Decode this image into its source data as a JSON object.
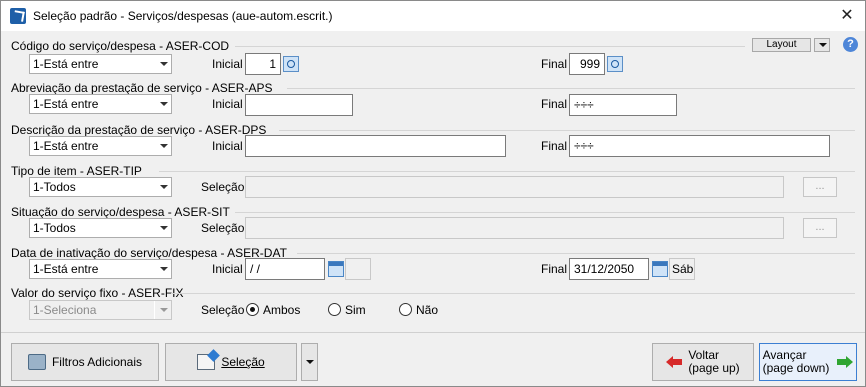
{
  "window": {
    "title": "Seleção padrão - Serviços/despesas (aue-autom.escrit.)",
    "close_glyph": "✕"
  },
  "toolbar": {
    "layout_label": "Layout",
    "help_glyph": "?"
  },
  "groups": [
    {
      "title": "Código do serviço/despesa - ASER-COD",
      "mode": "1-Está entre",
      "left_label": "Inicial",
      "left_value": "1",
      "right_label": "Final",
      "right_value": "999"
    },
    {
      "title": "Abreviação da prestação de serviço - ASER-APS",
      "mode": "1-Está entre",
      "left_label": "Inicial",
      "left_value": "",
      "right_label": "Final",
      "right_value": "÷÷÷"
    },
    {
      "title": "Descrição da prestação de serviço - ASER-DPS",
      "mode": "1-Está entre",
      "left_label": "Inicial",
      "left_value": "",
      "right_label": "Final",
      "right_value": "÷÷÷"
    },
    {
      "title": "Tipo de item - ASER-TIP",
      "mode": "1-Todos",
      "left_label": "Seleção",
      "left_value": "",
      "browse": "..."
    },
    {
      "title": "Situação do serviço/despesa - ASER-SIT",
      "mode": "1-Todos",
      "left_label": "Seleção",
      "left_value": "",
      "browse": "..."
    },
    {
      "title": "Data de inativação do serviço/despesa - ASER-DAT",
      "mode": "1-Está entre",
      "left_label": "Inicial",
      "left_value": " / /",
      "right_label": "Final",
      "right_value": "31/12/2050",
      "day": "Sáb"
    },
    {
      "title": "Valor do serviço fixo - ASER-FIX",
      "mode": "1-Seleciona",
      "left_label": "Seleção",
      "options": [
        "Ambos",
        "Sim",
        "Não"
      ],
      "selected": "Ambos"
    }
  ],
  "footer": {
    "filters_label": "Filtros Adicionais",
    "selection_label": "Seleção",
    "back_line1": "Voltar",
    "back_line2": "(page up)",
    "next_line1": "Avançar",
    "next_line2": "(page down)"
  }
}
